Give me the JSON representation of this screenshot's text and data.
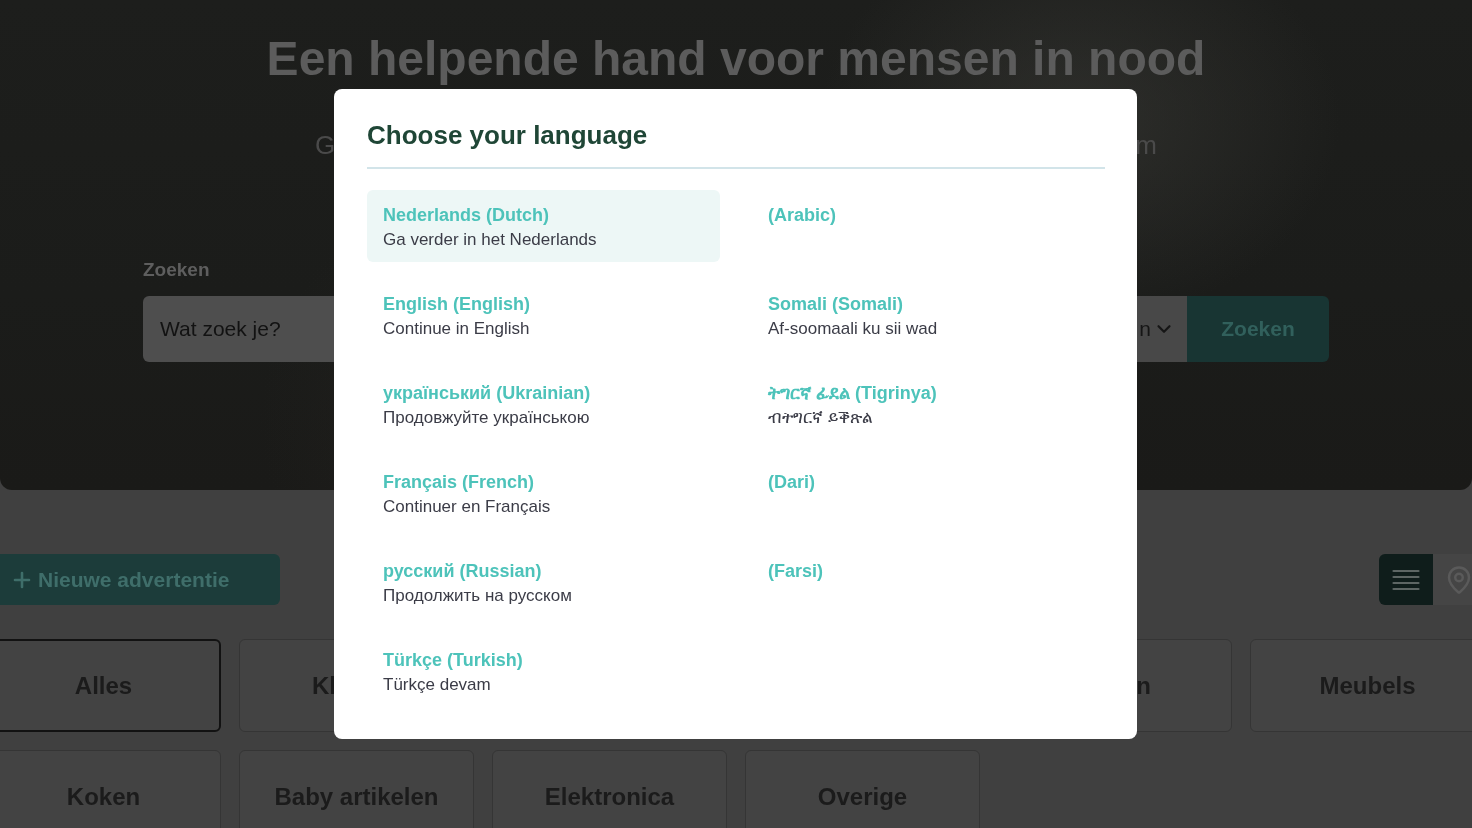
{
  "hero": {
    "title": "Een helpende hand voor mensen in nood",
    "subtitle_fragments": [
      "G",
      "m"
    ]
  },
  "search": {
    "label": "Zoeken",
    "placeholder": "Wat zoek je?",
    "select_value": "n",
    "button": "Zoeken"
  },
  "actions": {
    "new_ad_button": "Nieuwe advertentie",
    "view_toggle": [
      {
        "kind": "list",
        "selected": true
      },
      {
        "kind": "map",
        "selected": false
      }
    ]
  },
  "category_rows": [
    {
      "left": [
        {
          "label": "Alles",
          "selected": true
        }
      ],
      "left_partial": {
        "label": "Kl",
        "selected": false
      },
      "right_partial": {
        "label": "n",
        "selected": false
      },
      "right": [
        {
          "label": "Meubels",
          "selected": false
        }
      ]
    },
    {
      "left": [
        {
          "label": "Koken",
          "selected": false
        },
        {
          "label": "Baby artikelen",
          "selected": false
        },
        {
          "label": "Elektronica",
          "selected": false
        },
        {
          "label": "Overige",
          "selected": false
        }
      ]
    }
  ],
  "dialog": {
    "title": "Choose your language",
    "languages": [
      {
        "name": "Nederlands (Dutch)",
        "description": "Ga verder in het Nederlands",
        "selected": true
      },
      {
        "name": "(Arabic)",
        "selected": false
      },
      {
        "name": "English (English)",
        "description": "Continue in English",
        "selected": false
      },
      {
        "name": "Somali (Somali)",
        "description": "Af-soomaali ku sii wad",
        "selected": false
      },
      {
        "name": "український (Ukrainian)",
        "description": "Продовжуйте українською",
        "selected": false
      },
      {
        "name": "ትግርኛ ፊደል (Tigrinya)",
        "description": "ብትግርኛ ይቕጽል",
        "selected": false
      },
      {
        "name": "Français (French)",
        "description": "Continuer en Français",
        "selected": false
      },
      {
        "name": "(Dari)",
        "selected": false
      },
      {
        "name": "русский (Russian)",
        "description": "Продолжить на русском",
        "selected": false
      },
      {
        "name": "(Farsi)",
        "selected": false
      },
      {
        "name": "Türkçe (Turkish)",
        "description": "Türkçe devam",
        "selected": false
      }
    ]
  }
}
